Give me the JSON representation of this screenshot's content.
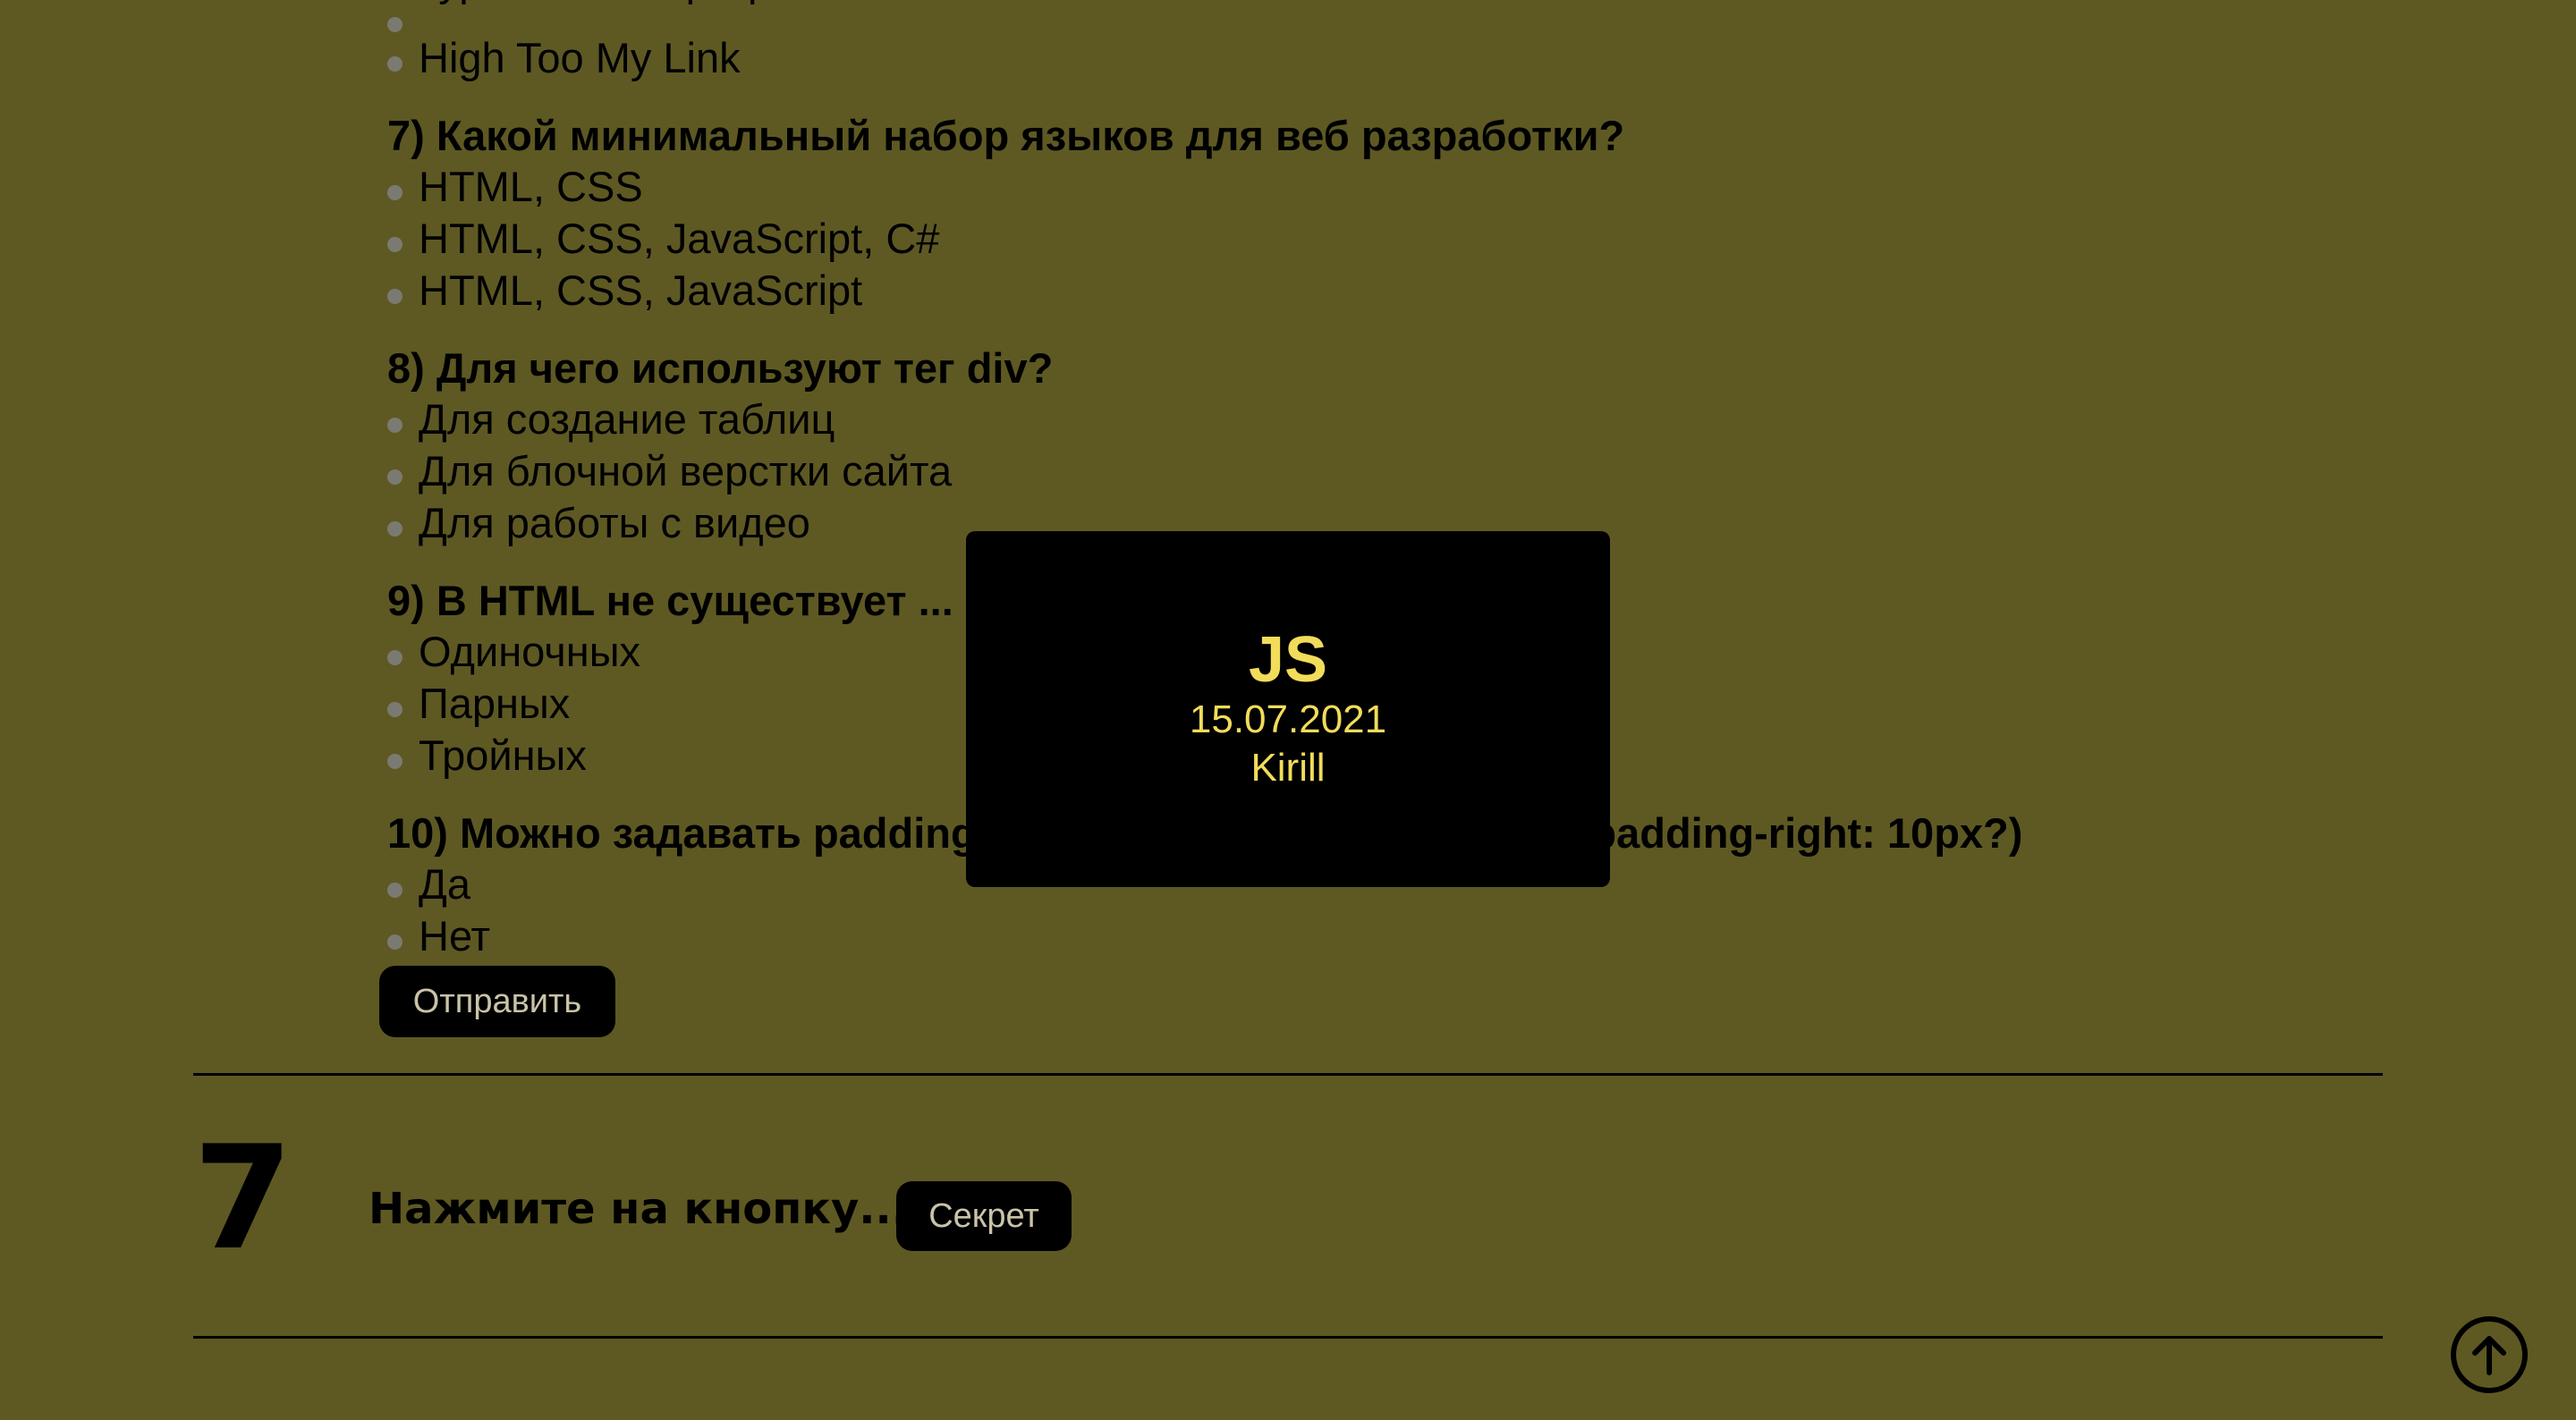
{
  "quiz": {
    "prev_option_cut": "Гурл с текст программ...",
    "prev_option_last": "High Too My Link",
    "questions": [
      {
        "title": "7) Какой минимальный набор языков для веб разработки?",
        "options": [
          "HTML, CSS",
          "HTML, CSS, JavaScript, C#",
          "HTML, CSS, JavaScript"
        ]
      },
      {
        "title": "8) Для чего используют тег div?",
        "options": [
          "Для создание таблиц",
          "Для блочной верстки сайта",
          "Для работы с видео"
        ]
      },
      {
        "title": "9) В HTML не существует ...",
        "options": [
          "Одиночных",
          "Парных",
          "Тройных"
        ]
      },
      {
        "title": "10) Можно задавать padding-left: 10px; padding-top: 10px; padding-right: 10px?)",
        "options": [
          "Да",
          "Нет"
        ]
      }
    ],
    "submit_label": "Отправить"
  },
  "section7": {
    "number": "7",
    "prompt": "Нажмите на кнопку...",
    "button_label": "Секрет"
  },
  "modal": {
    "title": "JS",
    "date": "15.07.2021",
    "author": "Kirill"
  },
  "scroll_top_icon": "arrow-up-circle-icon"
}
